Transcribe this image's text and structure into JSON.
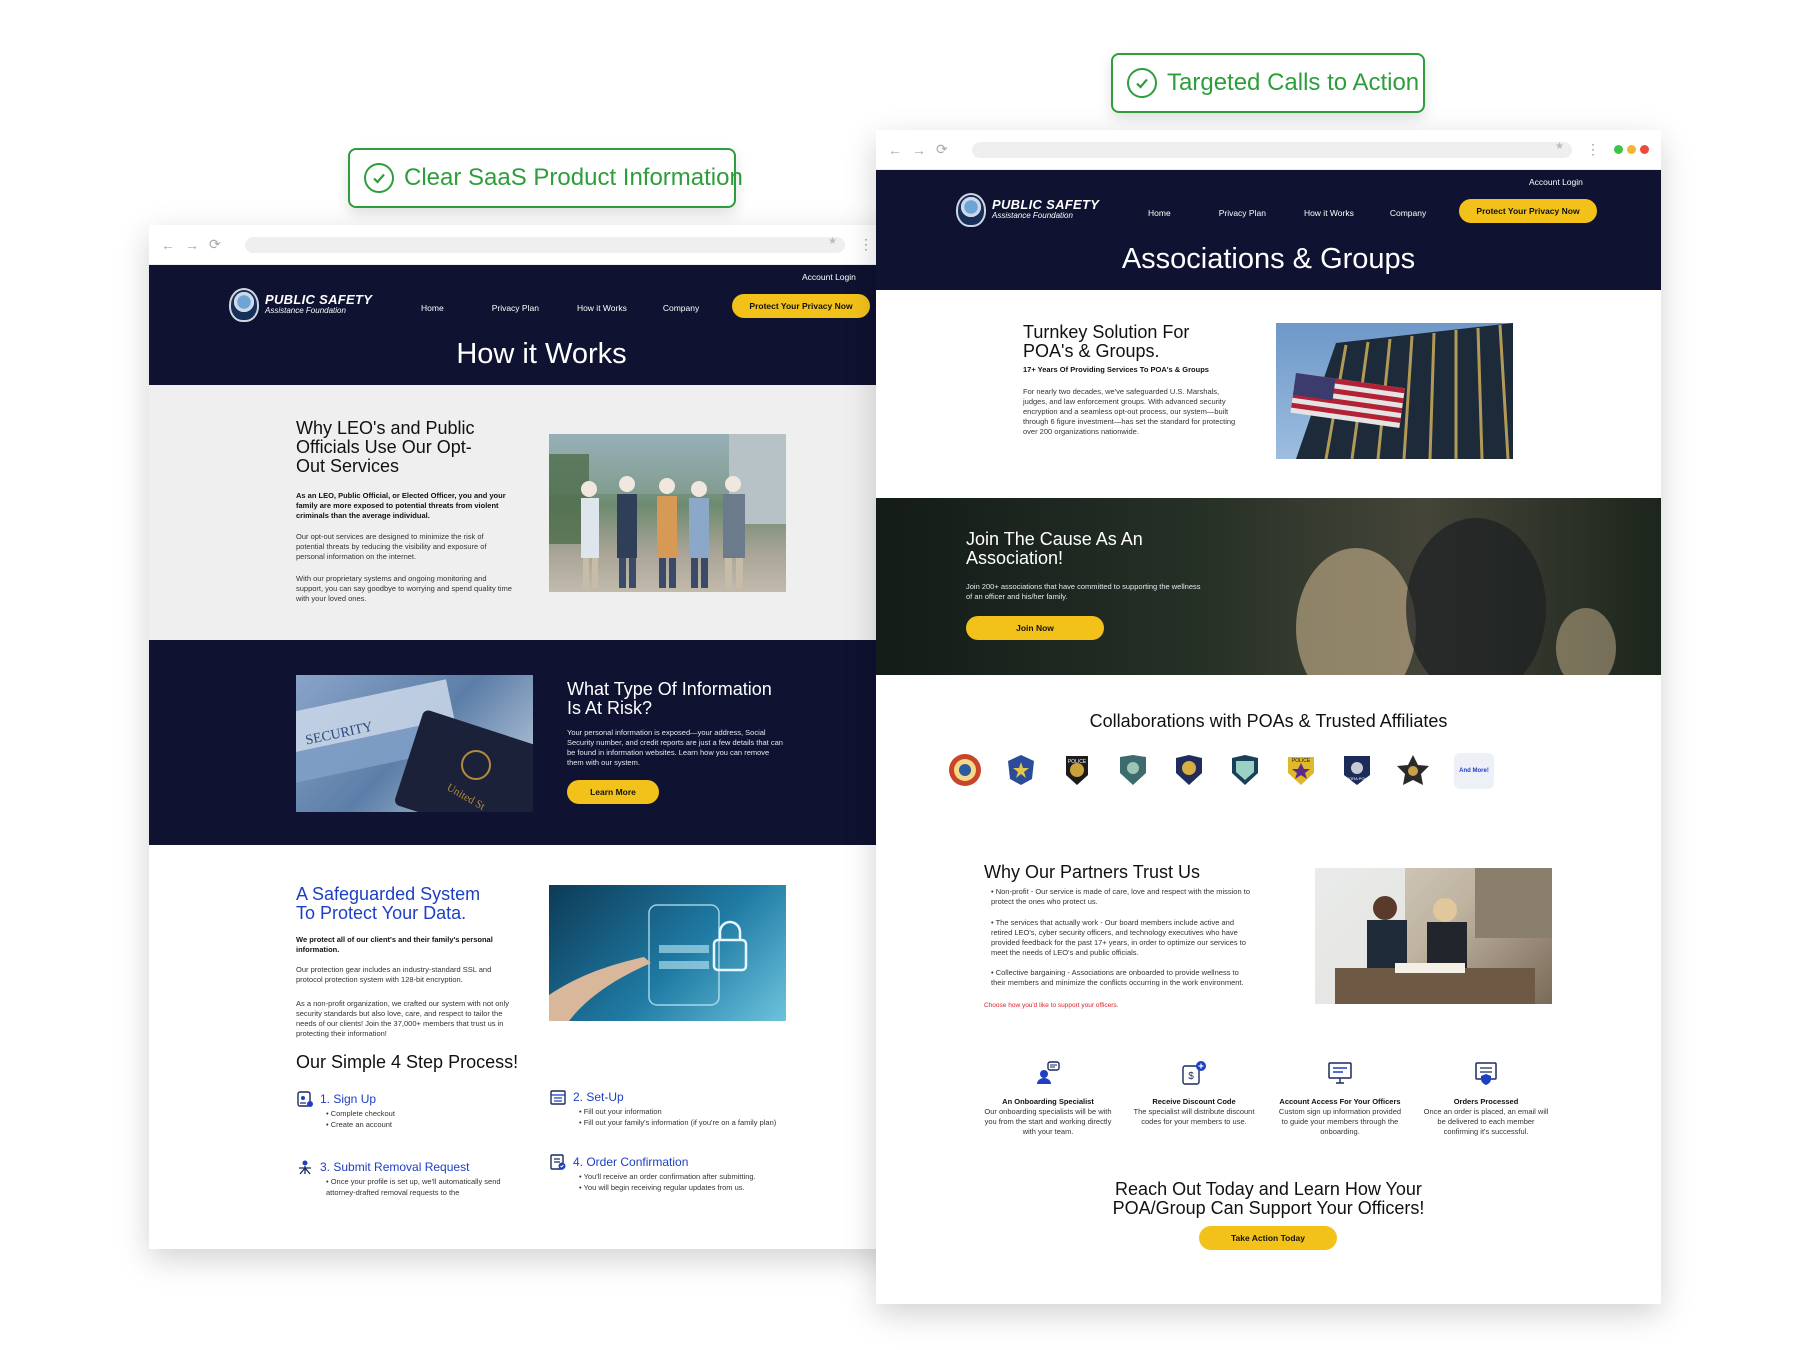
{
  "callouts": {
    "left": "Clear SaaS Product Information",
    "right": "Targeted Calls to Action"
  },
  "brand": {
    "name": "PUBLIC SAFETY",
    "sub": "Assistance Foundation",
    "navy": "#0f1230",
    "yellow": "#f2c21b",
    "blue": "#1d3fc4",
    "green": "#2e9e3c"
  },
  "nav": {
    "account_login": "Account Login",
    "home": "Home",
    "privacy_plan": "Privacy Plan",
    "how_it_works": "How it Works",
    "company": "Company",
    "cta": "Protect Your Privacy Now"
  },
  "left_page": {
    "title": "How it Works",
    "why": {
      "heading": "Why LEO's and Public Officials Use Our Opt-Out Services",
      "lead": "As an LEO, Public Official, or Elected Officer, you and your family are more exposed to potential threats from violent criminals than the average individual.",
      "p1": "Our opt-out services are designed to minimize the risk of potential threats by reducing the visibility and exposure of personal information on the internet.",
      "p2": "With our proprietary systems and ongoing monitoring and support, you can say goodbye to worrying and spend quality time with your loved ones."
    },
    "risk": {
      "heading": "What Type Of Information Is At Risk?",
      "body": "Your personal information is exposed—your address, Social Security number, and credit reports are just a few details that can be found in information websites. Learn how you can remove them with our system.",
      "button": "Learn More"
    },
    "safeguard": {
      "heading": "A Safeguarded System To Protect Your Data.",
      "lead": "We protect all of our client's and their family's personal information.",
      "p1": "Our protection gear includes an industry-standard SSL and protocol protection system with 128-bit encryption.",
      "p2": "As a non-profit organization, we crafted our system with not only security standards but also love, care, and respect to tailor the needs of our clients! Join the 37,000+ members that trust us in protecting their information!"
    },
    "process": {
      "heading": "Our Simple 4 Step Process!",
      "steps": [
        {
          "title": "1. Sign Up",
          "items": [
            "Complete checkout",
            "Create an account"
          ]
        },
        {
          "title": "2. Set-Up",
          "items": [
            "Fill out your information",
            "Fill out your family's information (if you're on a family plan)"
          ]
        },
        {
          "title": "3. Submit Removal Request",
          "items": [
            "Once your profile is set up, we'll automatically send attorney-drafted removal requests to the"
          ]
        },
        {
          "title": "4. Order Confirmation",
          "items": [
            "You'll receive an order confirmation after submitting.",
            "You will begin receiving regular updates from us."
          ]
        }
      ]
    }
  },
  "right_page": {
    "title": "Associations & Groups",
    "turnkey": {
      "heading": "Turnkey Solution For POA's & Groups.",
      "sub": "17+ Years Of Providing Services To POA's & Groups",
      "body": "For nearly two decades, we've safeguarded U.S. Marshals, judges, and law enforcement groups. With advanced security encryption and a seamless opt-out process, our system—built through 6 figure investment—has set the standard for protecting over 200 organizations nationwide."
    },
    "join": {
      "heading": "Join The Cause As An Association!",
      "body": "Join 200+ associations that have committed to supporting the wellness of an officer and his/her family.",
      "button": "Join Now"
    },
    "collab": {
      "heading": "Collaborations with POAs & Trusted Affiliates",
      "more": "And More!",
      "badges": [
        "seal-red-icon",
        "star-badge-icon",
        "police-badge-icon",
        "shield-green-icon",
        "shield-gold-icon",
        "shield-teal-icon",
        "police-star-icon",
        "aurora-police-icon",
        "star-dark-icon"
      ],
      "badge_texts": [
        "POLICE",
        "POLICE",
        "AURORA POLICE"
      ]
    },
    "trust": {
      "heading": "Why Our Partners Trust Us",
      "bullets": [
        "Non-profit - Our service is made of care, love and respect with the mission to protect the ones who protect us.",
        "The services that actually work - Our board members include active and retired LEO's, cyber security officers, and technology executives who have provided feedback for the past 17+ years, in order to optimize our services to meet the needs of LEO's and public officials.",
        "Collective bargaining - Associations are onboarded to provide wellness to their members and minimize the conflicts occurring in the work environment."
      ],
      "link": "Choose how you'd like to support your officers."
    },
    "features": [
      {
        "title": "An Onboarding Specialist",
        "desc": "Our onboarding specialists will be with you from the start and working directly with your team."
      },
      {
        "title": "Receive Discount Code",
        "desc": "The specialist will distribute discount codes for your members to use."
      },
      {
        "title": "Account Access For Your Officers",
        "desc": "Custom sign up information provided to guide your members through the onboarding."
      },
      {
        "title": "Orders Processed",
        "desc": "Once an order is placed, an email will be delivered to each member confirming it's successful."
      }
    ],
    "reach": {
      "heading": "Reach Out Today and Learn How Your POA/Group Can Support Your Officers!",
      "button": "Take Action Today"
    }
  }
}
